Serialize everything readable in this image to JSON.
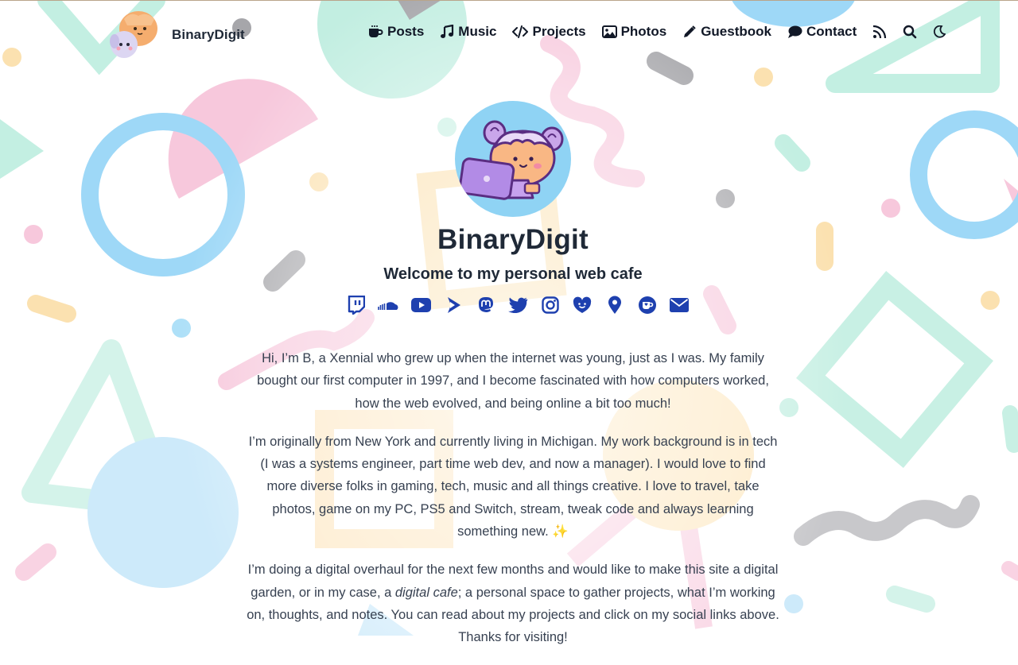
{
  "site": {
    "name": "BinaryDigit",
    "tagline": "Welcome to my personal web cafe"
  },
  "nav": {
    "items": [
      {
        "label": "Posts",
        "icon": "coffee-cup-icon"
      },
      {
        "label": "Music",
        "icon": "music-note-icon"
      },
      {
        "label": "Projects",
        "icon": "code-brackets-icon"
      },
      {
        "label": "Photos",
        "icon": "image-icon"
      },
      {
        "label": "Guestbook",
        "icon": "pencil-icon"
      },
      {
        "label": "Contact",
        "icon": "speech-bubble-icon"
      }
    ],
    "utility_icons": [
      "rss-icon",
      "search-icon",
      "moon-icon"
    ]
  },
  "socials": [
    "twitch-icon",
    "soundcloud-icon",
    "youtube-icon",
    "streamlabs-icon",
    "mastodon-icon",
    "twitter-icon",
    "instagram-icon",
    "ko-fi-icon",
    "location-pin-icon",
    "kofi-cup-icon",
    "email-icon"
  ],
  "bio": {
    "p1": "Hi, I’m B, a Xennial who grew up when the internet was young, just as I was. My family bought our first computer in 1997, and I become fascinated with how computers worked, how the web evolved, and being online a bit too much!",
    "p2": "I’m originally from New York and currently living in Michigan. My work background is in tech (I was a systems engineer, part time web dev, and now a manager). I would love to find more diverse folks in gaming, tech, music and all things creative. I love to travel, take photos, game on my PC, PS5 and Switch, stream, tweak code and always learning something new. ✨",
    "p3_before": "I’m doing a digital overhaul for the next few months and would like to make this site a digital garden, or in my case, a ",
    "p3_em": "digital cafe",
    "p3_after": "; a personal space to gather projects, what I’m working on, thoughts, and notes. You can read about my projects and click on my social links above. Thanks for visiting!"
  },
  "colors": {
    "accent": "#1e40af",
    "text": "#1f2937",
    "mint": "#b7ebdc",
    "pink": "#f7c8dc",
    "sky": "#9ed8f7",
    "butter": "#fbe1b0",
    "gray": "#a6a6aa"
  }
}
